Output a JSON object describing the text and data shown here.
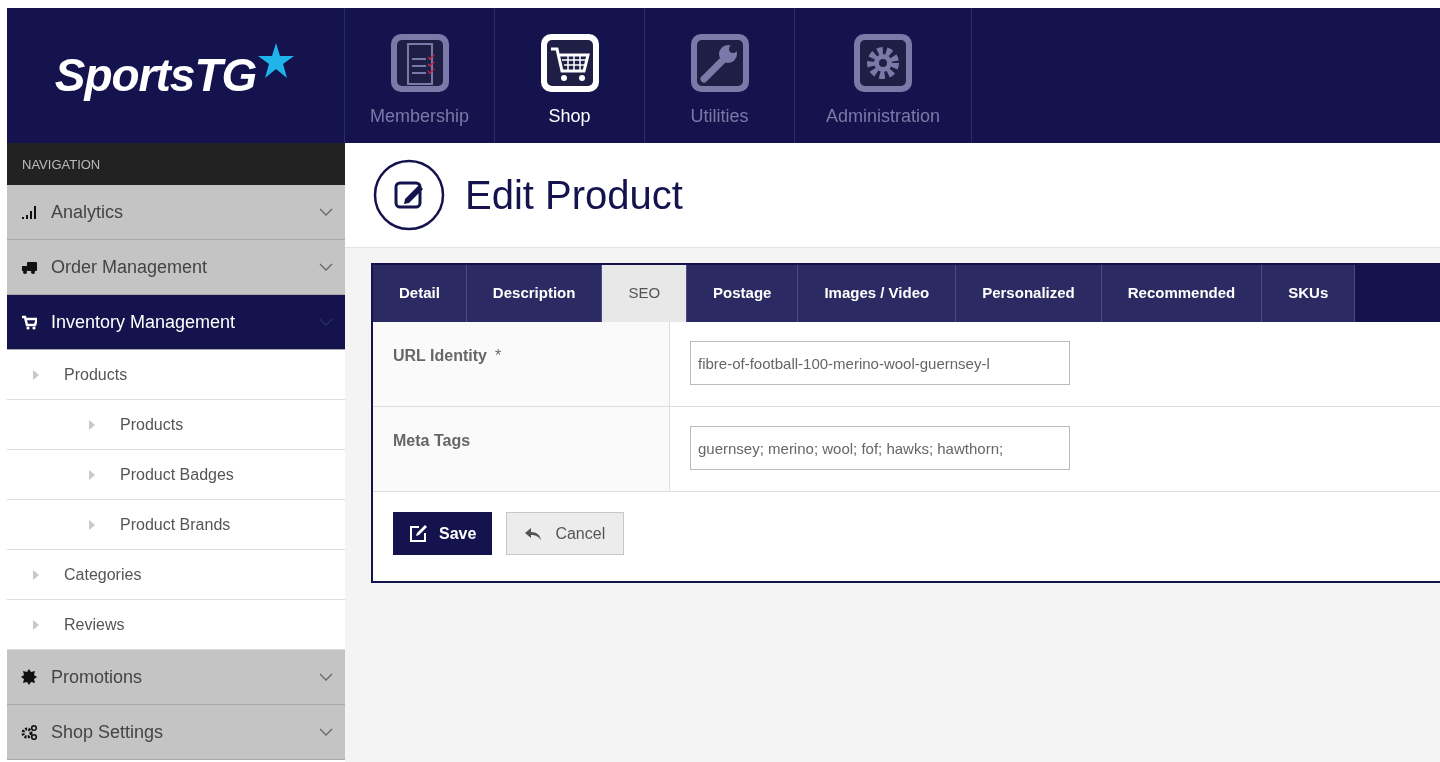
{
  "logo": {
    "text": "SportsTG"
  },
  "top_nav": [
    {
      "label": "Membership",
      "selected": false
    },
    {
      "label": "Shop",
      "selected": true
    },
    {
      "label": "Utilities",
      "selected": false
    },
    {
      "label": "Administration",
      "selected": false
    }
  ],
  "sidebar": {
    "heading": "NAVIGATION",
    "items": [
      {
        "label": "Analytics",
        "selected": false
      },
      {
        "label": "Order Management",
        "selected": false
      },
      {
        "label": "Inventory Management",
        "selected": true,
        "children": [
          {
            "label": "Products",
            "children": [
              {
                "label": "Products"
              },
              {
                "label": "Product Badges"
              },
              {
                "label": "Product Brands"
              }
            ]
          },
          {
            "label": "Categories"
          },
          {
            "label": "Reviews"
          }
        ]
      },
      {
        "label": "Promotions",
        "selected": false
      },
      {
        "label": "Shop Settings",
        "selected": false
      }
    ]
  },
  "page_title": "Edit Product",
  "tabs": [
    {
      "label": "Detail",
      "selected": false
    },
    {
      "label": "Description",
      "selected": false
    },
    {
      "label": "SEO",
      "selected": true
    },
    {
      "label": "Postage",
      "selected": false
    },
    {
      "label": "Images / Video",
      "selected": false
    },
    {
      "label": "Personalized",
      "selected": false
    },
    {
      "label": "Recommended",
      "selected": false
    },
    {
      "label": "SKUs",
      "selected": false
    }
  ],
  "fields": [
    {
      "label": "URL Identity",
      "required_mark": "*",
      "value": "fibre-of-football-100-merino-wool-guernsey-l"
    },
    {
      "label": "Meta Tags",
      "value": "guernsey; merino; wool; fof; hawks; hawthorn;"
    }
  ],
  "buttons": [
    {
      "kind": "primary",
      "label": "Save"
    },
    {
      "kind": "secondary",
      "label": "Cancel"
    }
  ]
}
